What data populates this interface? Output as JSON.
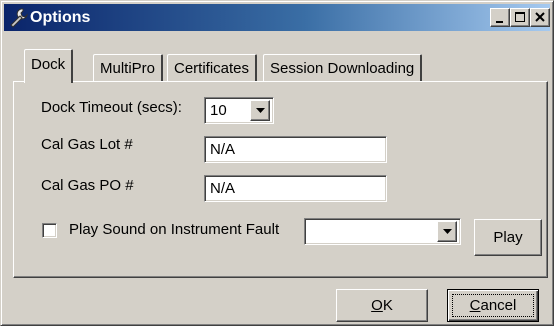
{
  "window": {
    "title": "Options",
    "title_icon": "wrench-icon",
    "controls": [
      "minimize-icon",
      "maximize-icon",
      "close-icon"
    ]
  },
  "tabs": [
    {
      "label": "Dock",
      "active": true
    },
    {
      "label": "MultiPro",
      "active": false
    },
    {
      "label": "Certificates",
      "active": false
    },
    {
      "label": "Session Downloading",
      "active": false
    }
  ],
  "dock": {
    "timeout_label": "Dock Timeout (secs):",
    "timeout_value": "10",
    "lot_label": "Cal Gas Lot #",
    "lot_value": "N/A",
    "po_label": "Cal Gas PO #",
    "po_value": "N/A",
    "sound_label": "Play Sound on Instrument Fault",
    "sound_checked": false,
    "sound_value": "",
    "play_label": "Play"
  },
  "footer": {
    "ok_accel": "O",
    "ok_rest": "K",
    "cancel_accel": "C",
    "cancel_rest": "ancel"
  }
}
